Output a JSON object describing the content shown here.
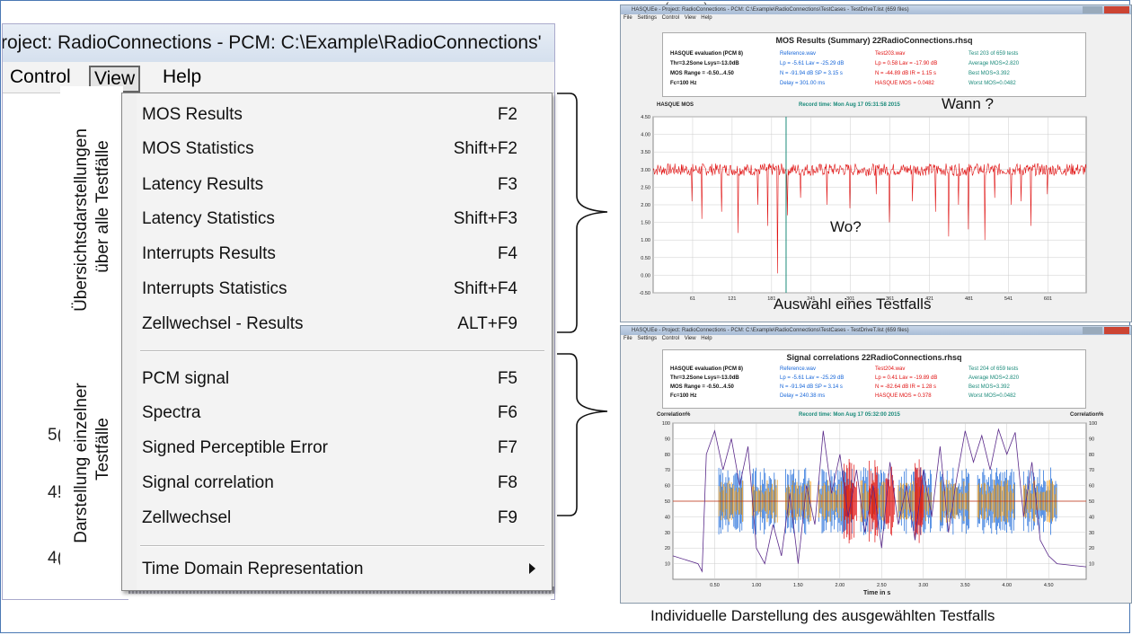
{
  "app": {
    "title": "roject: RadioConnections - PCM: C:\\Example\\RadioConnections'",
    "menus": [
      "Control",
      "View",
      "Help"
    ],
    "bg_numbers": [
      "5(",
      "4!",
      "4("
    ]
  },
  "dropdown": {
    "group1": [
      {
        "label": "MOS Results",
        "shortcut": "F2"
      },
      {
        "label": "MOS Statistics",
        "shortcut": "Shift+F2"
      },
      {
        "label": "Latency Results",
        "shortcut": "F3"
      },
      {
        "label": "Latency Statistics",
        "shortcut": "Shift+F3"
      },
      {
        "label": "Interrupts Results",
        "shortcut": "F4"
      },
      {
        "label": "Interrupts Statistics",
        "shortcut": "Shift+F4"
      },
      {
        "label": "Zellwechsel - Results",
        "shortcut": "ALT+F9"
      }
    ],
    "group2": [
      {
        "label": "PCM signal",
        "shortcut": "F5"
      },
      {
        "label": "Spectra",
        "shortcut": "F6"
      },
      {
        "label": "Signed Perceptible Error",
        "shortcut": "F7"
      },
      {
        "label": "Signal correlation",
        "shortcut": "F8"
      },
      {
        "label": "Zellwechsel",
        "shortcut": "F9"
      }
    ],
    "submenu": {
      "label": "Time Domain Representation",
      "icon": "submenu-arrow-icon"
    }
  },
  "annotations": {
    "overview_1": "Übersichtsdarstellungen",
    "overview_2": "über alle Testfälle",
    "single_1": "Darstellung einzelner",
    "single_2": "Testfälle",
    "when": "Wann ?",
    "where": "Wo?",
    "select": "Auswahl eines Testfalls",
    "individual": "Individuelle Darstellung des ausgewählten Testfalls",
    "top_cut": "(pag.ns)"
  },
  "win1": {
    "title": "HASQUEe - Project: RadioConnections - PCM: C:\\Example\\RadioConnections\\TestCases - TestDriveT.list (659 files)",
    "menu": "File Settings Control View Help",
    "panel_title": "MOS Results (Summary) 22RadioConnections.rhsq",
    "col1": [
      "HASQUE evaluation (PCM 8)",
      "Thr=3.2Sone Lsys=-13.0dB",
      "MOS Range = -0.50...4.50",
      "Fc=100 Hz"
    ],
    "col2": [
      "Reference.wav",
      "Lp = -5.61 Lav = -25.29 dB",
      "N = -91.94 dB SP = 3.15 s",
      "Delay = 301.00 ms"
    ],
    "col3": [
      "Test203.wav",
      "Lp = 0.58 Lav = -17.90 dB",
      "N = -44.89 dB IR = 1.15 s",
      "HASQUE MOS = 0.0482"
    ],
    "col4": [
      "Test 203 of 659 tests",
      "Average MOS=2.820",
      "Best MOS=3.392",
      "Worst MOS=0.0482"
    ],
    "chart_label": "HASQUE MOS",
    "record_time": "Record time: Mon Aug 17 05:31:58 2015"
  },
  "win2": {
    "title": "HASQUEe - Project: RadioConnections - PCM: C:\\Example\\RadioConnections\\TestCases - TestDriveT.list (659 files)",
    "menu": "File Settings Control View Help",
    "panel_title": "Signal correlations 22RadioConnections.rhsq",
    "col1": [
      "HASQUE evaluation (PCM 8)",
      "Thr=3.2Sone Lsys=-13.0dB",
      "MOS Range = -0.50...4.50",
      "Fc=100 Hz"
    ],
    "col2": [
      "Reference.wav",
      "Lp = -5.61 Lav = -25.29 dB",
      "N = -91.94 dB SP = 3.14 s",
      "Delay = 240.38 ms"
    ],
    "col3": [
      "Test204.wav",
      "Lp = 0.41 Lav = -19.89 dB",
      "N = -82.64 dB IR = 1.28 s",
      "HASQUE MOS = 0.378"
    ],
    "col4": [
      "Test 204 of 659 tests",
      "Average MOS=2.820",
      "Best MOS=3.392",
      "Worst MOS=0.0482"
    ],
    "ylabel_left": "Correlation%",
    "ylabel_right": "Correlation%",
    "record_time": "Record time: Mon Aug 17 05:32:00 2015",
    "xlabel": "Time in s"
  },
  "chart_data": [
    {
      "type": "line",
      "title": "",
      "ylabel": "HASQUE MOS",
      "ylim": [
        -0.5,
        4.5
      ],
      "yticks": [
        "4.50",
        "4.00",
        "3.50",
        "3.00",
        "2.50",
        "2.00",
        "1.50",
        "1.00",
        "0.50",
        "0.00",
        "-0.50"
      ],
      "xticks": [
        "61",
        "121",
        "181",
        "241",
        "301",
        "361",
        "421",
        "481",
        "541",
        "601"
      ],
      "xlim": [
        1,
        659
      ],
      "baseline": 3.0,
      "selected_test": 203,
      "dips": [
        [
          60,
          2.1
        ],
        [
          75,
          1.6
        ],
        [
          105,
          1.8
        ],
        [
          130,
          1.2
        ],
        [
          160,
          2.0
        ],
        [
          175,
          1.4
        ],
        [
          190,
          0.05
        ],
        [
          205,
          1.7
        ],
        [
          225,
          2.2
        ],
        [
          265,
          2.0
        ],
        [
          300,
          1.9
        ],
        [
          340,
          2.3
        ],
        [
          360,
          1.5
        ],
        [
          395,
          2.1
        ],
        [
          430,
          1.8
        ],
        [
          450,
          1.1
        ],
        [
          465,
          2.0
        ],
        [
          480,
          1.3
        ],
        [
          505,
          1.0
        ],
        [
          520,
          2.2
        ],
        [
          545,
          2.0
        ],
        [
          560,
          2.1
        ],
        [
          575,
          1.4
        ],
        [
          600,
          2.3
        ]
      ],
      "grid": true
    },
    {
      "type": "line",
      "title": "",
      "ylabel": "Correlation%",
      "xlabel": "Time in s",
      "ylim": [
        0,
        100
      ],
      "yticks": [
        "100",
        "90",
        "80",
        "70",
        "60",
        "50",
        "40",
        "30",
        "20",
        "10"
      ],
      "xticks": [
        "0.50",
        "1.00",
        "1.50",
        "2.00",
        "2.50",
        "3.00",
        "3.50",
        "4.00",
        "4.50"
      ],
      "xlim": [
        0,
        4.95
      ],
      "colors": {
        "correlation": "#5a2a8a",
        "reference": "#f39c12",
        "test": "#1565d8",
        "highlight": "#e01010",
        "baseline": "#c03010"
      },
      "grid": true
    }
  ]
}
